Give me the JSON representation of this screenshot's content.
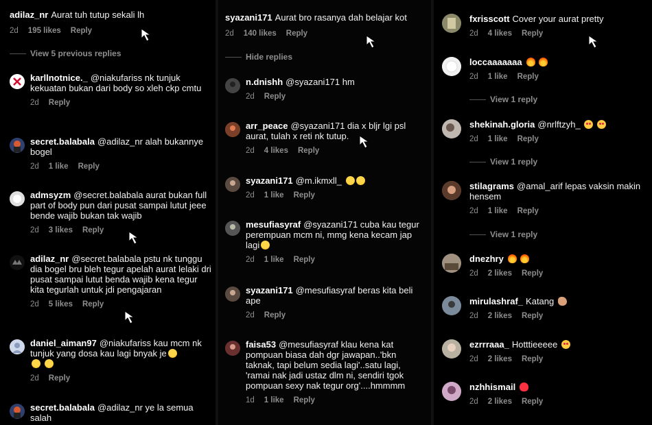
{
  "colors": {
    "background": "#000000",
    "text": "#f5f5f5",
    "muted": "#8e8e8e"
  },
  "col1": {
    "top": {
      "user": "adilaz_nr",
      "text": "Aurat tuh tutup sekali lh",
      "time": "2d",
      "likes": "195 likes",
      "reply": "Reply"
    },
    "view_prev": "View 5 previous replies",
    "comments": [
      {
        "user": "karllnotnice._",
        "text": "@niakufariss nk tunjuk kekuatan bukan dari body so xleh ckp cmtu",
        "time": "2d",
        "likes": "",
        "reply": "Reply"
      },
      {
        "user": "secret.balabala",
        "text": "@adilaz_nr alah bukannye bogel",
        "time": "2d",
        "likes": "1 like",
        "reply": "Reply"
      },
      {
        "user": "admsyzm",
        "text": "@secret.balabala aurat bukan full part of body pun dari pusat  sampai lutut jeee bende wajib bukan tak wajib",
        "time": "2d",
        "likes": "3 likes",
        "reply": "Reply"
      },
      {
        "user": "adilaz_nr",
        "text": "@secret.balabala pstu nk tunggu dia bogel bru bleh tegur apelah aurat lelaki dri pusat sampai lutut benda wajib kena tegur kita tegurlah untuk jdi pengajaran",
        "time": "2d",
        "likes": "5 likes",
        "reply": "Reply"
      },
      {
        "user": "daniel_aiman97",
        "text": "@niakufariss kau mcm nk tunjuk yang dosa kau lagi bnyak je",
        "time": "2d",
        "likes": "",
        "reply": "Reply"
      },
      {
        "user": "secret.balabala",
        "text": "@adilaz_nr ye la semua salah",
        "time": "",
        "likes": "",
        "reply": ""
      }
    ]
  },
  "col2": {
    "top": {
      "user": "syazani171",
      "text": "Aurat bro rasanya dah belajar kot",
      "time": "2d",
      "likes": "140 likes",
      "reply": "Reply"
    },
    "hide_replies": "Hide replies",
    "comments": [
      {
        "user": "n.dnishh",
        "text": "@syazani171 hm",
        "time": "2d",
        "likes": "",
        "reply": "Reply"
      },
      {
        "user": "arr_peace",
        "text": "@syazani171 dia x bljr lgi psl aurat, tulah x reti nk tutup.",
        "time": "2d",
        "likes": "4 likes",
        "reply": "Reply"
      },
      {
        "user": "syazani171",
        "text": "@m.ikmxll_",
        "time": "2d",
        "likes": "1 like",
        "reply": "Reply"
      },
      {
        "user": "mesufiasyraf",
        "text": "@syazani171 cuba kau tegur perempuan mcm ni, mmg kena kecam jap lagi",
        "time": "2d",
        "likes": "1 like",
        "reply": "Reply"
      },
      {
        "user": "syazani171",
        "text": "@mesufiasyraf beras kita beli ape",
        "time": "2d",
        "likes": "",
        "reply": "Reply"
      },
      {
        "user": "faisa53",
        "text": "@mesufiasyraf klau kena kat pompuan biasa dah dgr jawapan..'bkn taknak, tapi belum sedia lagi'..satu lagi, 'ramai nak jadi ustaz dlm ni, sendiri tgok pompuan sexy nak tegur org'....hmmmm",
        "time": "1d",
        "likes": "1 like",
        "reply": "Reply"
      }
    ]
  },
  "col3": {
    "comments": [
      {
        "user": "fxrisscott",
        "text": "Cover your aurat pretty",
        "time": "2d",
        "likes": "4 likes",
        "reply": "Reply"
      },
      {
        "user": "loccaaaaaaa",
        "text": "",
        "time": "2d",
        "likes": "1 like",
        "reply": "Reply",
        "view": "View 1 reply"
      },
      {
        "user": "shekinah.gloria",
        "text": "@nrlftzyh_",
        "time": "2d",
        "likes": "1 like",
        "reply": "Reply",
        "view": "View 1 reply"
      },
      {
        "user": "stilagrams",
        "text": "@amal_arif lepas vaksin makin hensem",
        "time": "2d",
        "likes": "1 like",
        "reply": "Reply",
        "view": "View 1 reply"
      },
      {
        "user": "dnezhry",
        "text": "",
        "time": "2d",
        "likes": "2 likes",
        "reply": "Reply"
      },
      {
        "user": "mirulashraf_",
        "text": "Katang",
        "time": "2d",
        "likes": "2 likes",
        "reply": "Reply"
      },
      {
        "user": "ezrrraaa_",
        "text": "Hotttieeeee",
        "time": "2d",
        "likes": "2 likes",
        "reply": "Reply"
      },
      {
        "user": "nzhhismail",
        "text": "",
        "time": "2d",
        "likes": "2 likes",
        "reply": "Reply"
      }
    ]
  }
}
